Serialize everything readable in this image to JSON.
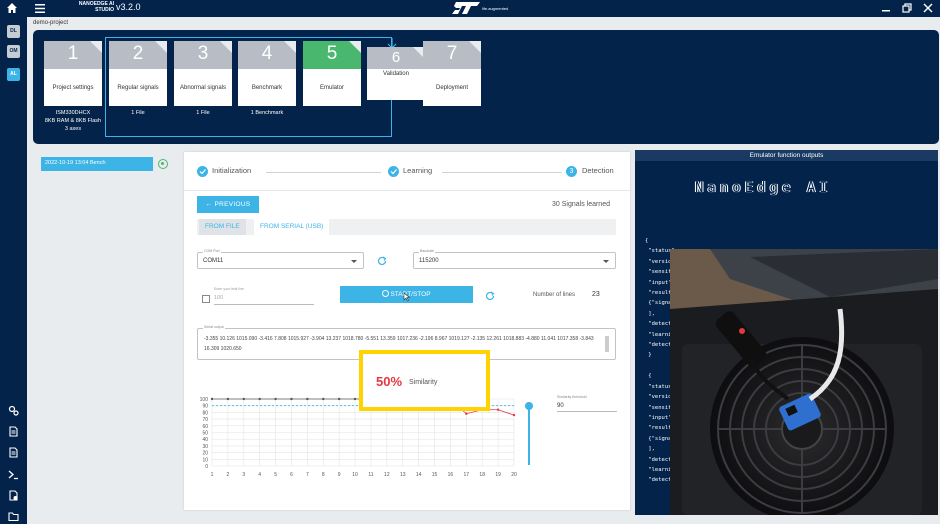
{
  "app": {
    "brand_line1": "NANOEDGE AI",
    "brand_line2": "STUDIO",
    "version": "v3.2.0",
    "tagline": "life.augmented"
  },
  "sidebar": {
    "badges": [
      {
        "label": "DL",
        "color": "#c6ccd4"
      },
      {
        "label": "OM",
        "color": "#c6ccd4"
      },
      {
        "label": "AL",
        "color": "#3cb4e6"
      }
    ],
    "icons": [
      "settings-icon",
      "document-icon",
      "document-icon",
      "terminal-icon",
      "file-export-icon",
      "folder-icon"
    ]
  },
  "project": {
    "name": "demo-project"
  },
  "steps": [
    {
      "num": "1",
      "label": "Project settings",
      "active": false
    },
    {
      "num": "2",
      "label": "Regular signals",
      "active": false
    },
    {
      "num": "3",
      "label": "Abnormal signals",
      "active": false
    },
    {
      "num": "4",
      "label": "Benchmark",
      "active": false
    },
    {
      "num": "5",
      "label": "Emulator",
      "active": true
    },
    {
      "num": "6",
      "label": "Validation",
      "active": false
    },
    {
      "num": "7",
      "label": "Deployment",
      "active": false
    }
  ],
  "step_details": {
    "project_line1": "ISM330DHCX",
    "project_line2": "8KB RAM & 8KB Flash",
    "project_line3": "3 axes",
    "regular": "1 File",
    "abnormal": "1 File",
    "benchmark": "1 Benchmark"
  },
  "session": {
    "label": "2022-10-19 13:04 Bench"
  },
  "progress": {
    "stages": [
      "Initialization",
      "Learning",
      "Detection"
    ],
    "current_stage_num": "3"
  },
  "controls": {
    "previous_label": "← PREVIOUS",
    "signals_learned": "30 Signals learned",
    "tab_file": "FROM FILE",
    "tab_serial": "FROM SERIAL (USB)",
    "com_caption": "COM Port",
    "com_value": "COM11",
    "baud_caption": "Baudrate",
    "baud_value": "115200",
    "max_lines_caption": "Enter your limit line",
    "max_lines_value": "100",
    "start_stop_label": "START/STOP",
    "lines_label": "Number of lines",
    "lines_value": "23",
    "serial_caption": "Serial output",
    "serial_text": "-3.355 10.126 1015.090 -3.416 7.808 1015.927 -3.904 13.237 1018.780 -5.551 13.359 1017.236 -2.196 8.967 1019.127 -2.135 12.261 1018.883 -4.880 11.041 1017.358 -3.843 16.309 1020.650",
    "threshold_caption": "Similarity threshold",
    "threshold_value": "90"
  },
  "similarity": {
    "percent": "50%",
    "label": "Similarity"
  },
  "chart_data": {
    "type": "line",
    "x": [
      1,
      2,
      3,
      4,
      5,
      6,
      7,
      8,
      9,
      10,
      11,
      12,
      13,
      14,
      15,
      16,
      17,
      18,
      19,
      20
    ],
    "series": [
      {
        "name": "",
        "color": "#555555",
        "values": [
          100,
          100,
          100,
          100,
          100,
          100,
          100,
          100,
          100,
          100,
          100,
          100,
          100,
          100,
          100,
          100,
          null,
          null,
          null,
          null
        ]
      },
      {
        "name": "",
        "color": "#e6363e",
        "values": [
          null,
          null,
          null,
          null,
          null,
          null,
          null,
          null,
          null,
          null,
          null,
          null,
          null,
          null,
          null,
          100,
          78,
          84,
          84,
          76
        ]
      }
    ],
    "threshold": 90,
    "ylim": [
      0,
      100
    ],
    "yticks": [
      0,
      10,
      20,
      30,
      40,
      50,
      60,
      70,
      80,
      90,
      100
    ],
    "xlabel": "",
    "ylabel": "",
    "grid": true
  },
  "right_panel": {
    "title": "Emulator function outputs",
    "ascii_art": "NanoEdge AI",
    "json_lines": [
      "{",
      " \"status\"",
      " \"version",
      " \"sensiti",
      " \"input\"",
      " \"result",
      " {\"signal",
      " ],",
      " \"detect",
      " \"learni",
      " \"detect",
      " }",
      "",
      " {",
      " \"status",
      " \"version",
      " \"sensiti",
      " \"input\"",
      " \"result",
      " {\"signal",
      " ],",
      " \"detect",
      " \"learni",
      " \"detect"
    ]
  }
}
